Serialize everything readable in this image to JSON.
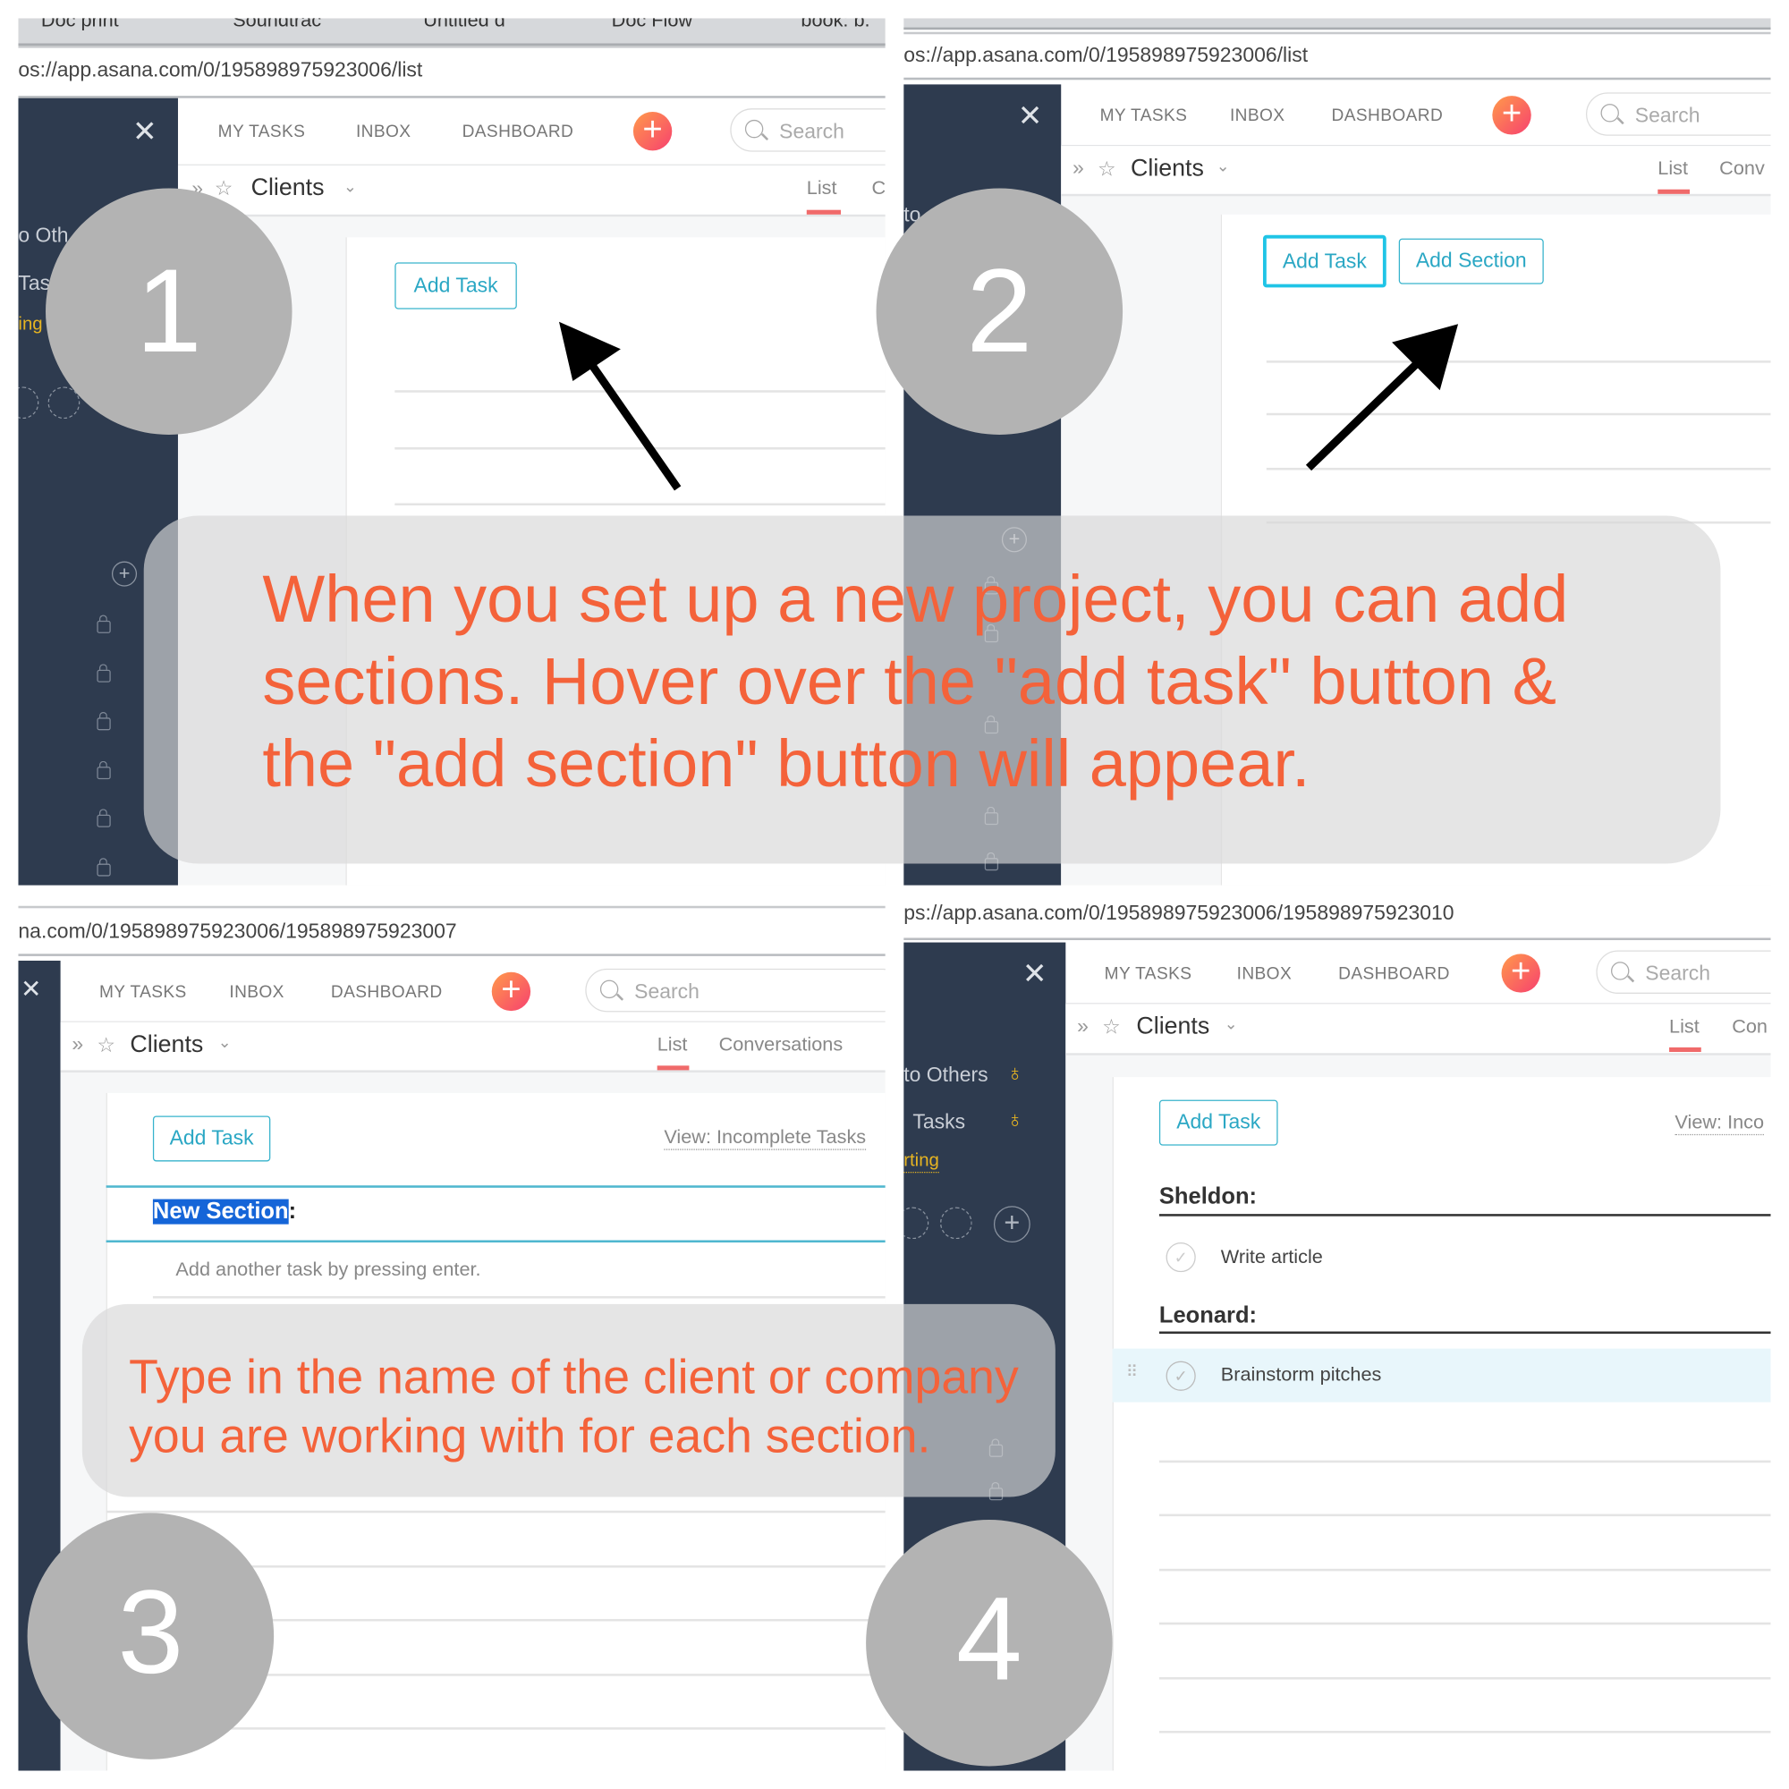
{
  "caption_top": {
    "line1": "When you set up a new project, you can add",
    "line2": "sections. Hover over the \"add task\" button &",
    "line3": "the \"add section\" button will appear."
  },
  "caption_bottom": {
    "line1": "Type in the name of the client or company",
    "line2": "you are working with for each section."
  },
  "colors": {
    "accent_orange": "#f4623a",
    "button_teal": "#37b3cc",
    "sidebar": "#2e3b4f",
    "step_circle": "#b3b3b3"
  },
  "nav": {
    "my_tasks": "MY TASKS",
    "inbox": "INBOX",
    "dashboard": "DASHBOARD",
    "search_placeholder": "Search",
    "add_icon": "plus-icon"
  },
  "project": {
    "name": "Clients",
    "tab_list": "List"
  },
  "panel1": {
    "step": "1",
    "tabs": [
      "Doc print",
      "Soundtrac",
      "Untitled d",
      "Doc Flow",
      "book: b."
    ],
    "url": "os://app.asana.com/0/195898975923006/list",
    "tab_partial": "C",
    "add_task": "Add Task",
    "sidebar": [
      "o Oth",
      "Tas",
      "ing"
    ]
  },
  "panel2": {
    "step": "2",
    "url": "os://app.asana.com/0/195898975923006/list",
    "tab_conv": "Conv",
    "add_task": "Add Task",
    "add_section": "Add Section",
    "sidebar": [
      "to"
    ]
  },
  "panel3": {
    "step": "3",
    "url": "na.com/0/195898975923006/195898975923007",
    "tab_conv": "Conversations",
    "add_task": "Add Task",
    "view": "View: Incomplete Tasks",
    "section_name": "New Section",
    "section_colon": ":",
    "task_hint": "Add another task by pressing enter."
  },
  "panel4": {
    "step": "4",
    "url": "ps://app.asana.com/0/195898975923006/195898975923010",
    "tab_conv": "Con",
    "add_task": "Add Task",
    "view": "View: Inco",
    "sidebar": [
      "to Others",
      "Tasks",
      "rting"
    ],
    "sections": [
      {
        "name": "Sheldon:",
        "tasks": [
          "Write article"
        ]
      },
      {
        "name": "Leonard:",
        "tasks": [
          "Brainstorm pitches"
        ]
      }
    ]
  }
}
